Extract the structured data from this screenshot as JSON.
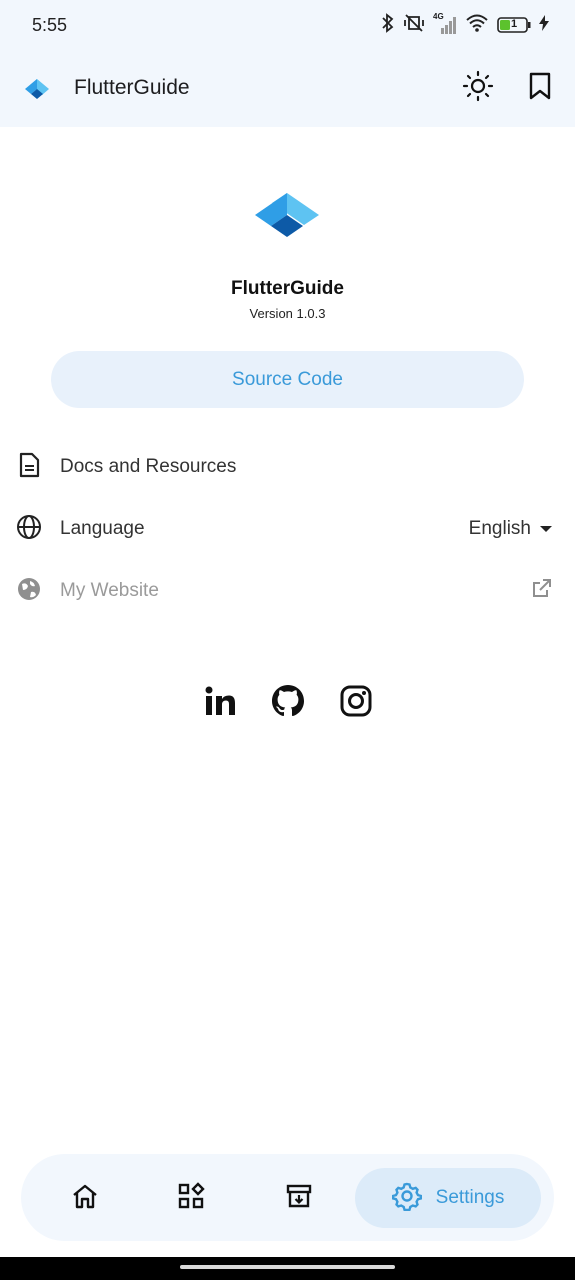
{
  "status_bar": {
    "time": "5:55",
    "network": "4G",
    "battery": "1"
  },
  "app_bar": {
    "title": "FlutterGuide"
  },
  "brand": {
    "name": "FlutterGuide",
    "version": "Version 1.0.3"
  },
  "source_button": {
    "label": "Source Code"
  },
  "settings": {
    "docs": {
      "label": "Docs and Resources"
    },
    "language": {
      "label": "Language",
      "value": "English"
    },
    "website": {
      "label": "My Website"
    }
  },
  "bottom_nav": {
    "active_label": "Settings"
  },
  "colors": {
    "accent": "#3a9ad9",
    "tint_bg": "#f2f7fd",
    "logo_light": "#5ec3f2",
    "logo_dark": "#0d5aa7"
  },
  "icons": [
    "bluetooth-icon",
    "vibrate-off-icon",
    "signal-icon",
    "wifi-icon",
    "battery-icon",
    "charging-icon",
    "brightness-icon",
    "bookmark-icon",
    "document-icon",
    "globe-icon",
    "website-globe-icon",
    "external-link-icon",
    "linkedin-icon",
    "github-icon",
    "instagram-icon",
    "home-icon",
    "apps-icon",
    "archive-icon",
    "settings-icon"
  ]
}
